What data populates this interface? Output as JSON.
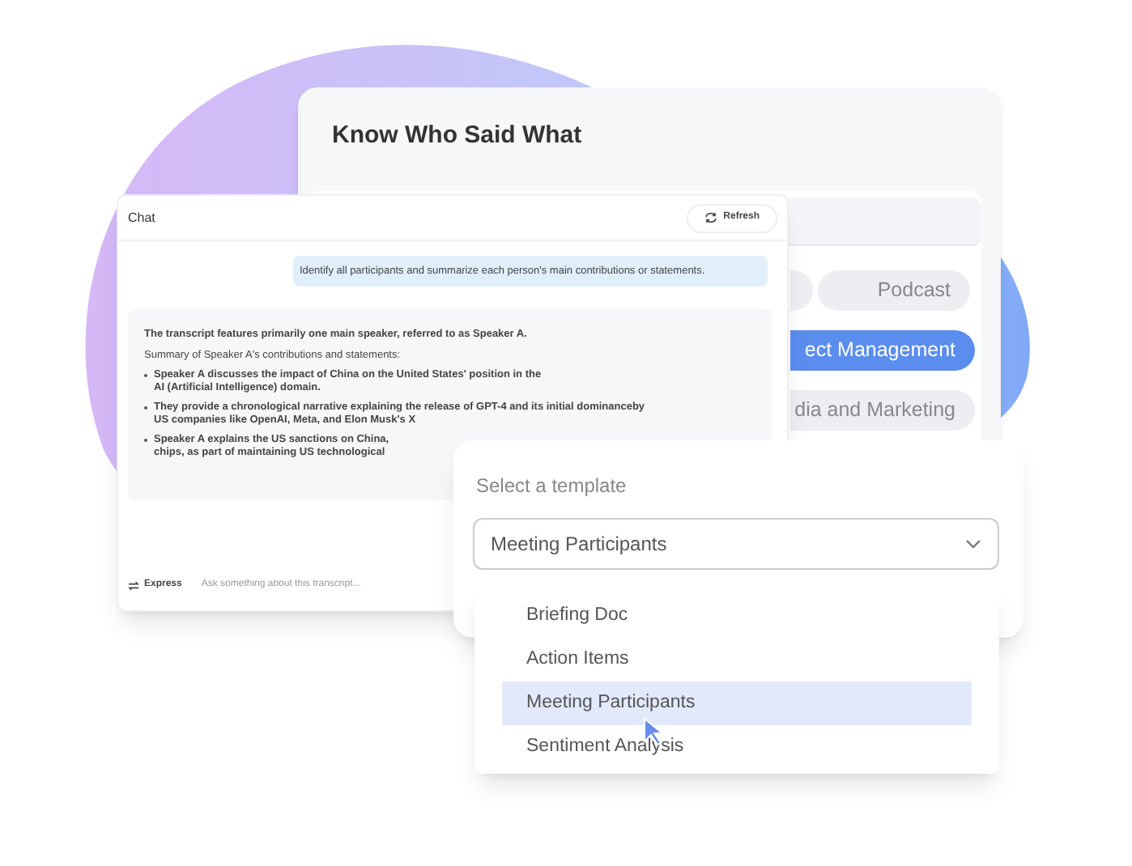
{
  "main_card": {
    "title": "Know Who Said What",
    "chips": [
      {
        "selected": false
      },
      {
        "label": "Podcast",
        "selected": false
      },
      {
        "label": "ect Management",
        "selected": true
      },
      {
        "label": "dia and Marketing",
        "selected": false
      }
    ]
  },
  "chat": {
    "title": "Chat",
    "refresh_button": "Refresh",
    "user_message": "Identify all participants and summarize each person's main contributions or statements.",
    "answer": {
      "intro": "The transcript features primarily one main speaker, referred to as Speaker A.",
      "subtitle": "Summary of Speaker A's contributions and statements:",
      "bullets": [
        {
          "lines": [
            "Speaker A discusses the impact of China on the United States' position in the",
            "AI (Artificial Intelligence) domain."
          ]
        },
        {
          "lines": [
            "They provide a chronological narrative explaining the release of GPT-4 and its initial dominanceby",
            "US companies like OpenAI, Meta, and Elon Musk's X"
          ]
        },
        {
          "lines": [
            "Speaker A explains the US sanctions on China,",
            "chips, as part of maintaining US technological"
          ]
        }
      ]
    },
    "mode_button": "Express",
    "input": {
      "placeholder": "Ask something about this transcript..."
    }
  },
  "template": {
    "label": "Select a template",
    "value": "Meeting Participants",
    "options": [
      {
        "label": "Briefing Doc",
        "selected": false
      },
      {
        "label": "Action Items",
        "selected": false
      },
      {
        "label": "Meeting Participants",
        "selected": true
      },
      {
        "label": "Sentiment Analysis",
        "selected": false
      }
    ]
  }
}
